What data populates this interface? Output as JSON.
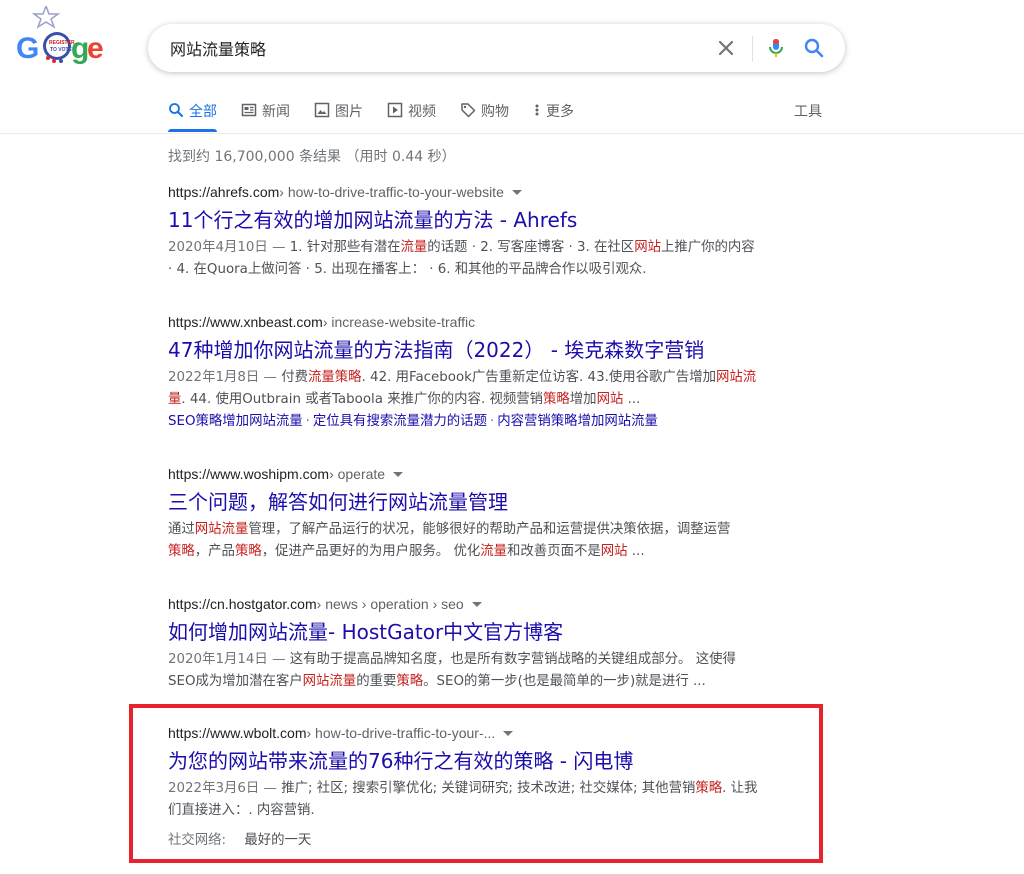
{
  "search": {
    "query": "网站流量策略",
    "placeholder": ""
  },
  "tabs": [
    {
      "label": "全部",
      "icon": "search-icon",
      "active": true
    },
    {
      "label": "新闻",
      "icon": "news-icon",
      "active": false
    },
    {
      "label": "图片",
      "icon": "image-icon",
      "active": false
    },
    {
      "label": "视频",
      "icon": "video-icon",
      "active": false
    },
    {
      "label": "购物",
      "icon": "tag-icon",
      "active": false
    },
    {
      "label": "更多",
      "icon": "more-vert-icon",
      "active": false
    }
  ],
  "tools_label": "工具",
  "result_stats": "找到约 16,700,000 条结果 （用时 0.44 秒）",
  "results": [
    {
      "domain": "https://ahrefs.com",
      "path": " › how-to-drive-traffic-to-your-website",
      "title": "11个行之有效的增加网站流量的方法 - Ahrefs",
      "snippet_line1": [
        {
          "t": "2020年4月10日 — ",
          "c": "d"
        },
        {
          "t": "1. 针对那些有潜在",
          "c": ""
        },
        {
          "t": "流量",
          "c": "em"
        },
        {
          "t": "的话题 · 2. 写客座博客 · 3. 在社区",
          "c": ""
        },
        {
          "t": "网站",
          "c": "em"
        },
        {
          "t": "上推广你的内容",
          "c": ""
        }
      ],
      "snippet_line2": [
        {
          "t": "· 4. 在Quora上做问答 · 5. 出现在播客上： · 6. 和其他的平品牌合作以吸引观众.",
          "c": ""
        }
      ]
    },
    {
      "domain": "https://www.xnbeast.com",
      "path": " › increase-website-traffic",
      "title": "47种增加你网站流量的方法指南（2022） - 埃克森数字营销",
      "snippet_line1": [
        {
          "t": "2022年1月8日 — ",
          "c": "d"
        },
        {
          "t": "付费",
          "c": ""
        },
        {
          "t": "流量策略",
          "c": "em"
        },
        {
          "t": ". 42. 用Facebook广告重新定位访客. 43.使用谷歌广告增加",
          "c": ""
        },
        {
          "t": "网站流",
          "c": "em"
        }
      ],
      "snippet_line2": [
        {
          "t": "量",
          "c": "em"
        },
        {
          "t": ". 44. 使用Outbrain 或者Taboola 来推广你的内容. 视频营销",
          "c": ""
        },
        {
          "t": "策略",
          "c": "em"
        },
        {
          "t": "增加",
          "c": ""
        },
        {
          "t": "网站",
          "c": "em"
        },
        {
          "t": " ...",
          "c": ""
        }
      ],
      "sitelinks": [
        "SEO策略增加网站流量",
        "定位具有搜索流量潜力的话题",
        "内容营销策略增加网站流量"
      ]
    },
    {
      "domain": "https://www.woshipm.com",
      "path": " › operate",
      "title": "三个问题，解答如何进行网站流量管理",
      "snippet_line1": [
        {
          "t": "通过",
          "c": ""
        },
        {
          "t": "网站流量",
          "c": "em"
        },
        {
          "t": "管理，了解产品运行的状况，能够很好的帮助产品和运营提供决策依据，调整运营",
          "c": ""
        }
      ],
      "snippet_line2": [
        {
          "t": "策略",
          "c": "em"
        },
        {
          "t": "，产品",
          "c": ""
        },
        {
          "t": "策略",
          "c": "em"
        },
        {
          "t": "，促进产品更好的为用户服务。 优化",
          "c": ""
        },
        {
          "t": "流量",
          "c": "em"
        },
        {
          "t": "和改善页面不是",
          "c": ""
        },
        {
          "t": "网站",
          "c": "em"
        },
        {
          "t": " ...",
          "c": ""
        }
      ]
    },
    {
      "domain": "https://cn.hostgator.com",
      "path": " › news › operation › seo",
      "title": "如何增加网站流量- HostGator中文官方博客",
      "snippet_line1": [
        {
          "t": "2020年1月14日 — ",
          "c": "d"
        },
        {
          "t": "这有助于提高品牌知名度，也是所有数字营销战略的关键组成部分。 这使得",
          "c": ""
        }
      ],
      "snippet_line2": [
        {
          "t": "SEO成为增加潜在客户",
          "c": ""
        },
        {
          "t": "网站流量",
          "c": "em"
        },
        {
          "t": "的重要",
          "c": ""
        },
        {
          "t": "策略",
          "c": "em"
        },
        {
          "t": "。SEO的第一步(也是最简单的一步)就是进行 ...",
          "c": ""
        }
      ]
    },
    {
      "domain": "https://www.wbolt.com",
      "path": " › how-to-drive-traffic-to-your-...",
      "title": "为您的网站带来流量的76种行之有效的策略 - 闪电博",
      "snippet_line1": [
        {
          "t": "2022年3月6日 — ",
          "c": "d"
        },
        {
          "t": "推广; 社区; 搜索引擎优化; 关键词研究; 技术改进; 社交媒体; 其他营销",
          "c": ""
        },
        {
          "t": "策略",
          "c": "em"
        },
        {
          "t": ". 让我",
          "c": ""
        }
      ],
      "snippet_line2": [
        {
          "t": "们直接进入：. 内容营销.",
          "c": ""
        }
      ],
      "extra_label": "社交网络:",
      "extra_value": "最好的一天"
    }
  ],
  "colors": {
    "link": "#1a0dab",
    "accent": "#1a73e8",
    "highlight_term": "#c5221f",
    "annotation_box": "#e8232e"
  }
}
